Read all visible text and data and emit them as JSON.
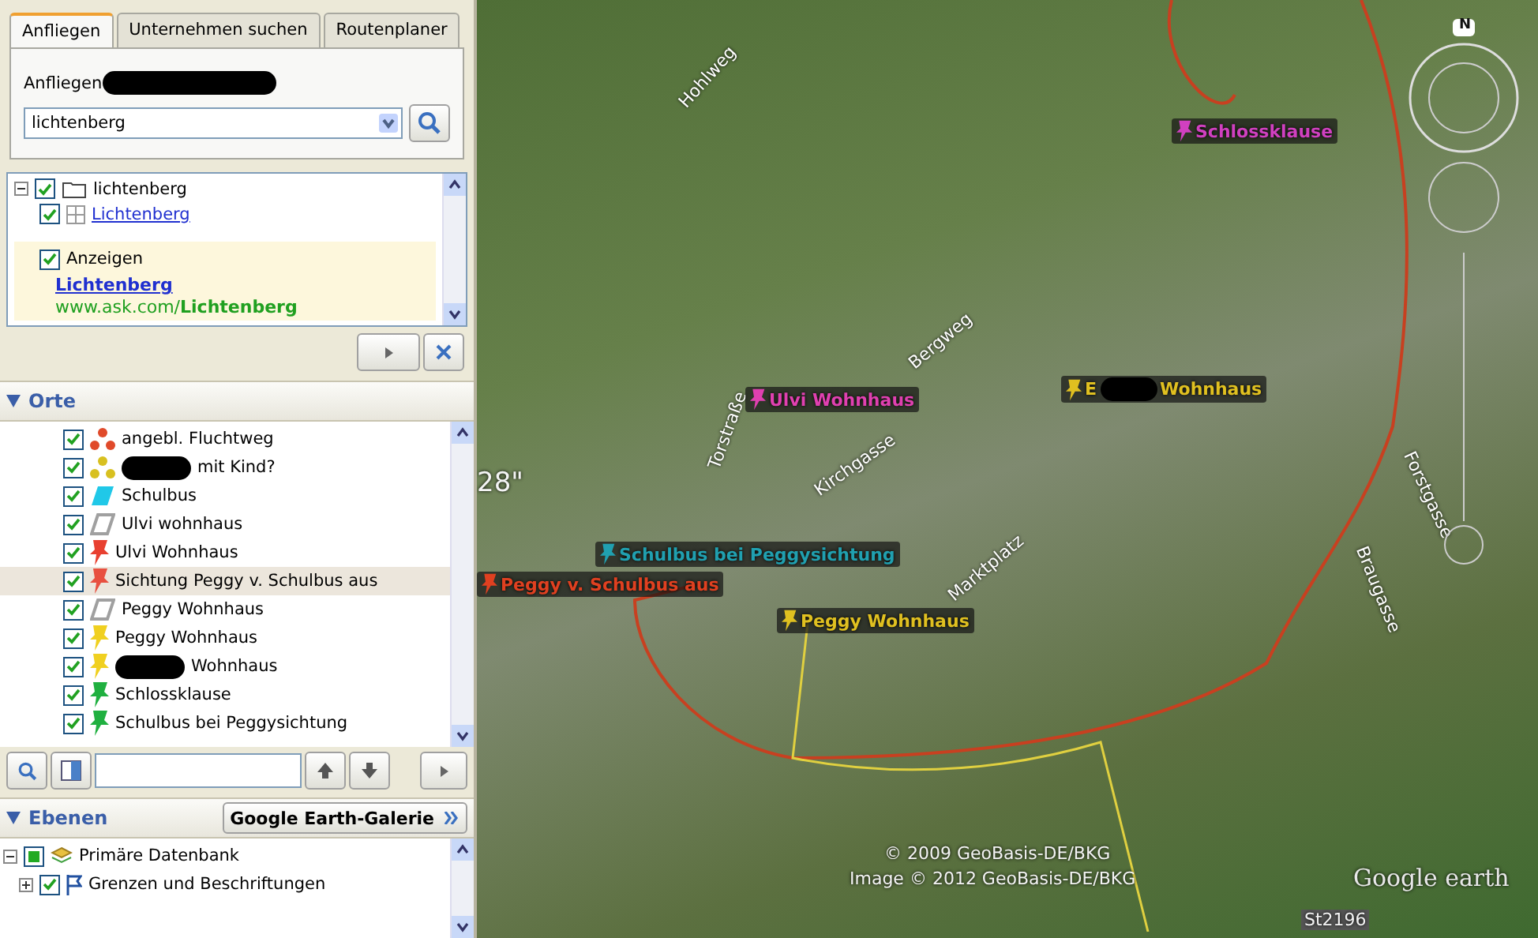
{
  "search": {
    "tabs": [
      {
        "label": "Anfliegen",
        "selected": true
      },
      {
        "label": "Unternehmen suchen",
        "selected": false
      },
      {
        "label": "Routenplaner",
        "selected": false
      }
    ],
    "fly_to_label": "Anfliegen",
    "fly_to_redacted": true,
    "query": "lichtenberg"
  },
  "results": {
    "root": {
      "label": "lichtenberg",
      "checked": true,
      "expanded": true
    },
    "children": [
      {
        "kind": "link",
        "label": "Lichtenberg",
        "checked": true
      },
      {
        "kind": "ad",
        "label": "Anzeigen",
        "checked": true,
        "title": "Lichtenberg",
        "url": "www.ask.com/**Lichtenberg**"
      }
    ]
  },
  "places": {
    "title": "Orte",
    "expanded": true,
    "items": [
      {
        "kind": "path",
        "label": "angebl. Fluchtweg",
        "checked": true,
        "selected": false,
        "color": "#e04a2a",
        "redacted": false
      },
      {
        "kind": "path",
        "label": "mit Kind?",
        "checked": true,
        "selected": false,
        "color": "#d8c020",
        "redacted": true
      },
      {
        "kind": "polygon",
        "label": "Schulbus",
        "checked": true,
        "selected": false,
        "color": "#20c8e8",
        "redacted": false
      },
      {
        "kind": "outline",
        "label": "Ulvi wohnhaus",
        "checked": true,
        "selected": false,
        "color": "#a0a0a0",
        "redacted": false
      },
      {
        "kind": "pin",
        "label": "Ulvi Wohnhaus",
        "checked": true,
        "selected": false,
        "color": "#e84030",
        "redacted": false
      },
      {
        "kind": "pin",
        "label": "Sichtung Peggy v. Schulbus aus",
        "checked": true,
        "selected": true,
        "color": "#e85040",
        "redacted": false
      },
      {
        "kind": "outline",
        "label": "Peggy Wohnhaus",
        "checked": true,
        "selected": false,
        "color": "#a0a0a0",
        "redacted": false
      },
      {
        "kind": "pin",
        "label": "Peggy Wohnhaus",
        "checked": true,
        "selected": false,
        "color": "#f0d020",
        "redacted": false
      },
      {
        "kind": "pin",
        "label": "Wohnhaus",
        "checked": true,
        "selected": false,
        "color": "#f0d020",
        "redacted": true
      },
      {
        "kind": "pin",
        "label": "Schlossklause",
        "checked": true,
        "selected": false,
        "color": "#20b040",
        "redacted": false
      },
      {
        "kind": "pin",
        "label": "Schulbus bei Peggysichtung",
        "checked": true,
        "selected": false,
        "color": "#20b040",
        "redacted": false
      }
    ]
  },
  "layers": {
    "title": "Ebenen",
    "expanded": true,
    "gallery_button": "Google Earth-Galerie",
    "items": [
      {
        "label": "Primäre Datenbank",
        "checked": true,
        "expanded": true,
        "children": [
          {
            "label": "Grenzen und Beschriftungen",
            "checked": true,
            "expanded": false
          }
        ]
      }
    ]
  },
  "map": {
    "labels": [
      {
        "kind": "street",
        "text": "Hohlweg"
      },
      {
        "kind": "street",
        "text": "Torstraße"
      },
      {
        "kind": "street",
        "text": "Bergweg"
      },
      {
        "kind": "street",
        "text": "Kirchgasse"
      },
      {
        "kind": "street",
        "text": "Forstgasse"
      },
      {
        "kind": "street",
        "text": "Braugasse"
      },
      {
        "kind": "street",
        "text": "Marktplatz"
      },
      {
        "kind": "placemark",
        "text": "Schlossklause",
        "color": "#d040c0"
      },
      {
        "kind": "placemark",
        "text": "Ulvi Wohnhaus",
        "color": "#e040b0"
      },
      {
        "kind": "placemark",
        "text": "Wohnhaus",
        "color": "#e0c020",
        "prefix": "E",
        "redacted": true
      },
      {
        "kind": "placemark",
        "text": "Schulbus bei Peggysichtung",
        "color": "#20a0b0"
      },
      {
        "kind": "placemark",
        "text": "Peggy v. Schulbus aus",
        "color": "#e04020"
      },
      {
        "kind": "placemark",
        "text": "Peggy Wohnhaus",
        "color": "#e0c020"
      }
    ],
    "coordinate_fragment": "28\"",
    "road_label": "St2196",
    "copyright": [
      "© 2009 GeoBasis-DE/BKG",
      "Image © 2012 GeoBasis-DE/BKG"
    ],
    "logo": "Google earth",
    "compass_letter": "N"
  }
}
